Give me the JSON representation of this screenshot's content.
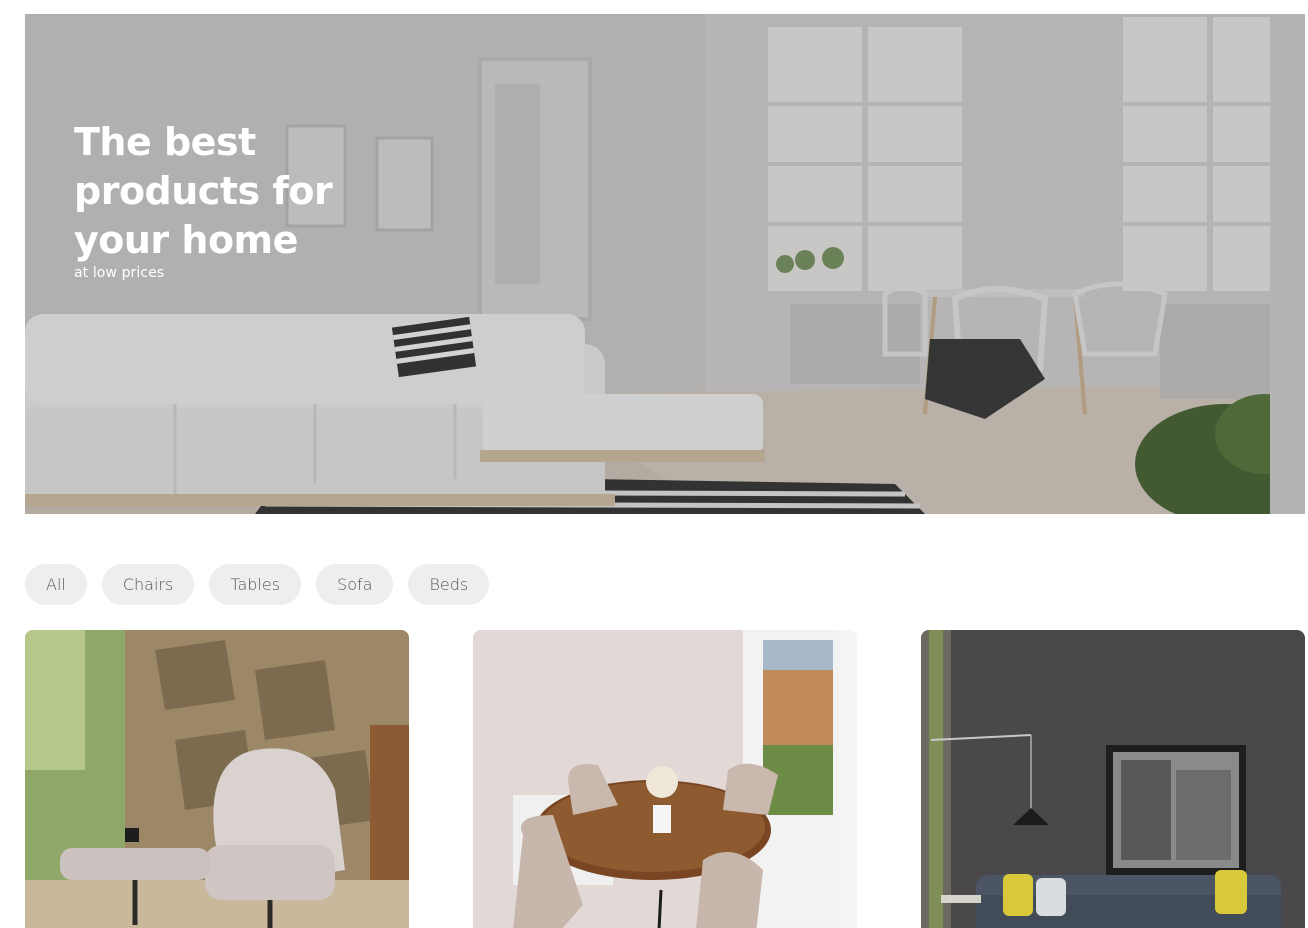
{
  "hero": {
    "title": "The best\nproducts for\nyour home",
    "subtitle": "at low prices"
  },
  "filters": [
    "All",
    "Chairs",
    "Tables",
    "Sofa",
    "Beds"
  ],
  "products": [
    {
      "image": "armchair-photo"
    },
    {
      "image": "dining-table-photo"
    },
    {
      "image": "sofa-photo"
    }
  ]
}
